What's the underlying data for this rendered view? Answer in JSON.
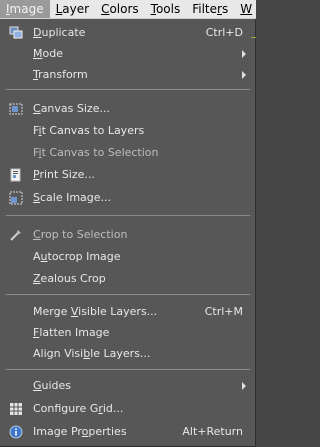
{
  "menubar": {
    "items": [
      {
        "pre": "",
        "u": "I",
        "post": "mage"
      },
      {
        "pre": "",
        "u": "L",
        "post": "ayer"
      },
      {
        "pre": "",
        "u": "C",
        "post": "olors"
      },
      {
        "pre": "",
        "u": "T",
        "post": "ools"
      },
      {
        "pre": "Filte",
        "u": "r",
        "post": "s"
      },
      {
        "pre": "",
        "u": "W",
        "post": ""
      }
    ]
  },
  "menu": {
    "items": [
      {
        "pre": "",
        "u": "D",
        "post": "uplicate",
        "shortcut": "Ctrl+D",
        "icon": "duplicate-icon"
      },
      {
        "pre": "",
        "u": "M",
        "post": "ode",
        "submenu": true
      },
      {
        "pre": "",
        "u": "T",
        "post": "ransform",
        "submenu": true
      },
      {
        "pre": "",
        "u": "C",
        "post": "anvas Size...",
        "icon": "canvas-size-icon"
      },
      {
        "pre": "F",
        "u": "i",
        "post": "t Canvas to Layers"
      },
      {
        "pre": "F",
        "u": "i",
        "post": "t Canvas to Selection"
      },
      {
        "pre": "",
        "u": "P",
        "post": "rint Size...",
        "icon": "print-size-icon"
      },
      {
        "pre": "",
        "u": "S",
        "post": "cale Image...",
        "icon": "scale-image-icon"
      },
      {
        "pre": "",
        "u": "C",
        "post": "rop to Selection",
        "icon": "crop-icon",
        "disabled": true
      },
      {
        "pre": "A",
        "u": "u",
        "post": "tocrop Image"
      },
      {
        "pre": "",
        "u": "Z",
        "post": "ealous Crop"
      },
      {
        "pre": "Merge ",
        "u": "V",
        "post": "isible Layers...",
        "shortcut": "Ctrl+M"
      },
      {
        "pre": "",
        "u": "F",
        "post": "latten Image"
      },
      {
        "pre": "Align Visi",
        "u": "b",
        "post": "le Layers..."
      },
      {
        "pre": "",
        "u": "G",
        "post": "uides",
        "submenu": true
      },
      {
        "pre": "Configure G",
        "u": "r",
        "post": "id...",
        "icon": "grid-icon"
      },
      {
        "pre": "Image Pr",
        "u": "o",
        "post": "perties",
        "shortcut": "Alt+Return",
        "icon": "info-icon"
      }
    ]
  }
}
